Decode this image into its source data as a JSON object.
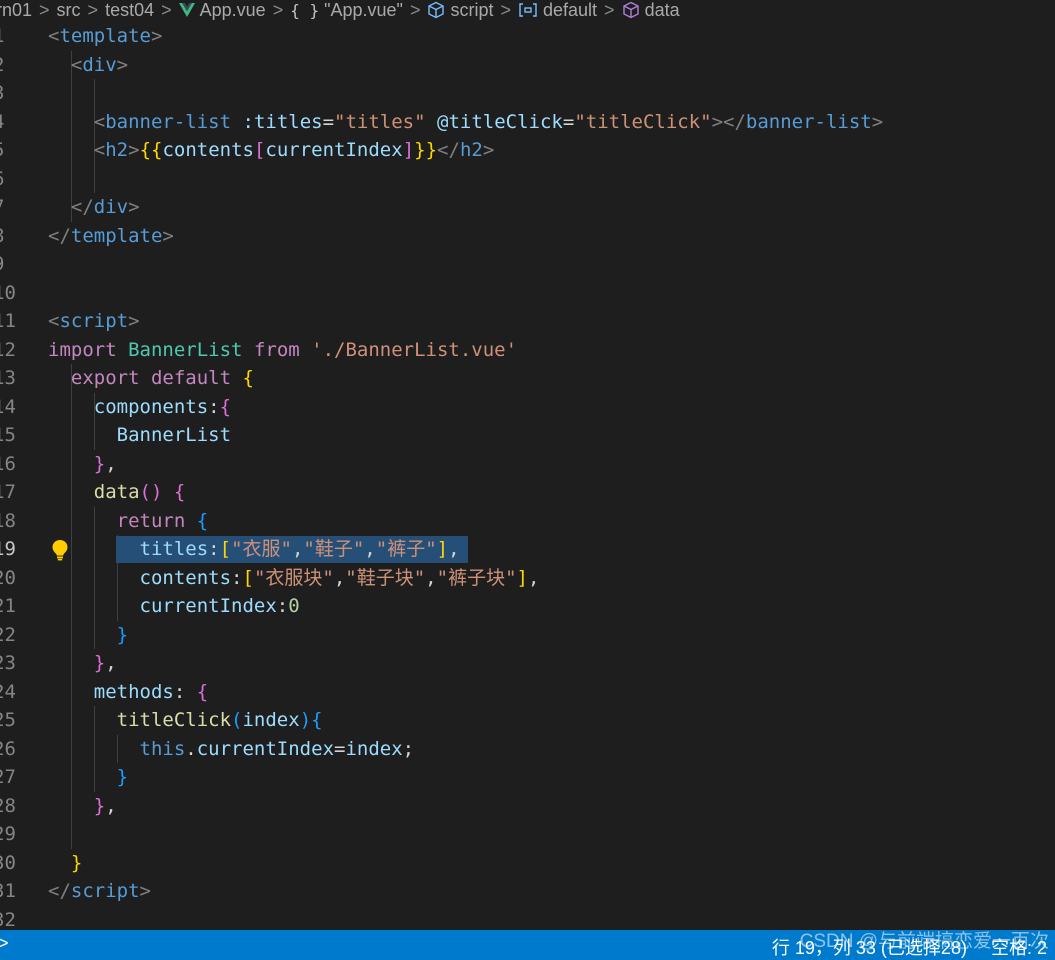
{
  "breadcrumb": {
    "items": [
      {
        "label": "rn01",
        "icon": ""
      },
      {
        "label": "src",
        "icon": ""
      },
      {
        "label": "test04",
        "icon": ""
      },
      {
        "label": "App.vue",
        "icon": "vue-icon"
      },
      {
        "label": "\"App.vue\"",
        "icon": "braces-icon"
      },
      {
        "label": "script",
        "icon": "cube-icon"
      },
      {
        "label": "default",
        "icon": "brackets-icon"
      },
      {
        "label": "data",
        "icon": "cube-icon"
      }
    ],
    "separator": ">"
  },
  "editor": {
    "active_line": 19,
    "lightbulb_line": 19,
    "lines": [
      {
        "num": "1",
        "tokens": [
          [
            "t-pun",
            "<"
          ],
          [
            "t-tag",
            "template"
          ],
          [
            "t-pun",
            ">"
          ]
        ]
      },
      {
        "num": "2",
        "tokens": [
          [
            "t-w",
            "  "
          ],
          [
            "t-pun",
            "<"
          ],
          [
            "t-tag",
            "div"
          ],
          [
            "t-pun",
            ">"
          ]
        ]
      },
      {
        "num": "3",
        "tokens": []
      },
      {
        "num": "4",
        "tokens": [
          [
            "t-w",
            "    "
          ],
          [
            "t-pun",
            "<"
          ],
          [
            "t-tag",
            "banner-list"
          ],
          [
            "t-w",
            " "
          ],
          [
            "t-attr",
            ":titles"
          ],
          [
            "t-w",
            "="
          ],
          [
            "t-str",
            "\"titles\""
          ],
          [
            "t-w",
            " "
          ],
          [
            "t-attr",
            "@titleClick"
          ],
          [
            "t-w",
            "="
          ],
          [
            "t-str",
            "\"titleClick\""
          ],
          [
            "t-pun",
            "></"
          ],
          [
            "t-tag",
            "banner-list"
          ],
          [
            "t-pun",
            ">"
          ]
        ]
      },
      {
        "num": "5",
        "tokens": [
          [
            "t-w",
            "    "
          ],
          [
            "t-pun",
            "<"
          ],
          [
            "t-tag",
            "h2"
          ],
          [
            "t-pun",
            ">"
          ],
          [
            "b1",
            "{{"
          ],
          [
            "t-prop",
            "contents"
          ],
          [
            "b2",
            "["
          ],
          [
            "t-prop",
            "currentIndex"
          ],
          [
            "b2",
            "]"
          ],
          [
            "b1",
            "}}"
          ],
          [
            "t-pun",
            "</"
          ],
          [
            "t-tag",
            "h2"
          ],
          [
            "t-pun",
            ">"
          ]
        ]
      },
      {
        "num": "6",
        "tokens": []
      },
      {
        "num": "7",
        "tokens": [
          [
            "t-w",
            "  "
          ],
          [
            "t-pun",
            "</"
          ],
          [
            "t-tag",
            "div"
          ],
          [
            "t-pun",
            ">"
          ]
        ]
      },
      {
        "num": "8",
        "tokens": [
          [
            "t-pun",
            "</"
          ],
          [
            "t-tag",
            "template"
          ],
          [
            "t-pun",
            ">"
          ]
        ]
      },
      {
        "num": "9",
        "tokens": []
      },
      {
        "num": "10",
        "tokens": []
      },
      {
        "num": "11",
        "tokens": [
          [
            "t-pun",
            "<"
          ],
          [
            "t-tag",
            "script"
          ],
          [
            "t-pun",
            ">"
          ]
        ]
      },
      {
        "num": "12",
        "tokens": [
          [
            "t-kw",
            "import"
          ],
          [
            "t-w",
            " "
          ],
          [
            "t-cls",
            "BannerList"
          ],
          [
            "t-w",
            " "
          ],
          [
            "t-kw",
            "from"
          ],
          [
            "t-w",
            " "
          ],
          [
            "t-str",
            "'./BannerList.vue'"
          ]
        ]
      },
      {
        "num": "13",
        "tokens": [
          [
            "t-w",
            "  "
          ],
          [
            "t-kw",
            "export"
          ],
          [
            "t-w",
            " "
          ],
          [
            "t-kw",
            "default"
          ],
          [
            "t-w",
            " "
          ],
          [
            "b1",
            "{"
          ]
        ]
      },
      {
        "num": "14",
        "tokens": [
          [
            "t-w",
            "    "
          ],
          [
            "t-prop",
            "components"
          ],
          [
            "t-w",
            ":"
          ],
          [
            "b2",
            "{"
          ]
        ]
      },
      {
        "num": "15",
        "tokens": [
          [
            "t-w",
            "      "
          ],
          [
            "t-prop",
            "BannerList"
          ]
        ]
      },
      {
        "num": "16",
        "tokens": [
          [
            "t-w",
            "    "
          ],
          [
            "b2",
            "}"
          ],
          [
            "t-w",
            ","
          ]
        ]
      },
      {
        "num": "17",
        "tokens": [
          [
            "t-w",
            "    "
          ],
          [
            "t-fn",
            "data"
          ],
          [
            "b2",
            "()"
          ],
          [
            "t-w",
            " "
          ],
          [
            "b2",
            "{"
          ]
        ]
      },
      {
        "num": "18",
        "tokens": [
          [
            "t-w",
            "      "
          ],
          [
            "t-kw",
            "return"
          ],
          [
            "t-w",
            " "
          ],
          [
            "b3",
            "{"
          ]
        ]
      },
      {
        "num": "19",
        "tokens": [
          [
            "t-w",
            "        "
          ],
          [
            "t-prop",
            "titles"
          ],
          [
            "t-w",
            ":"
          ],
          [
            "b1",
            "["
          ],
          [
            "t-str",
            "\"衣服\""
          ],
          [
            "t-w",
            ","
          ],
          [
            "t-str",
            "\"鞋子\""
          ],
          [
            "t-w",
            ","
          ],
          [
            "t-str",
            "\"裤子\""
          ],
          [
            "b1",
            "]"
          ],
          [
            "t-w",
            ","
          ]
        ]
      },
      {
        "num": "20",
        "tokens": [
          [
            "t-w",
            "        "
          ],
          [
            "t-prop",
            "contents"
          ],
          [
            "t-w",
            ":"
          ],
          [
            "b1",
            "["
          ],
          [
            "t-str",
            "\"衣服块\""
          ],
          [
            "t-w",
            ","
          ],
          [
            "t-str",
            "\"鞋子块\""
          ],
          [
            "t-w",
            ","
          ],
          [
            "t-str",
            "\"裤子块\""
          ],
          [
            "b1",
            "]"
          ],
          [
            "t-w",
            ","
          ]
        ]
      },
      {
        "num": "21",
        "tokens": [
          [
            "t-w",
            "        "
          ],
          [
            "t-prop",
            "currentIndex"
          ],
          [
            "t-w",
            ":"
          ],
          [
            "t-num",
            "0"
          ]
        ]
      },
      {
        "num": "22",
        "tokens": [
          [
            "t-w",
            "      "
          ],
          [
            "b3",
            "}"
          ]
        ]
      },
      {
        "num": "23",
        "tokens": [
          [
            "t-w",
            "    "
          ],
          [
            "b2",
            "}"
          ],
          [
            "t-w",
            ","
          ]
        ]
      },
      {
        "num": "24",
        "tokens": [
          [
            "t-w",
            "    "
          ],
          [
            "t-prop",
            "methods"
          ],
          [
            "t-w",
            ": "
          ],
          [
            "b2",
            "{"
          ]
        ]
      },
      {
        "num": "25",
        "tokens": [
          [
            "t-w",
            "      "
          ],
          [
            "t-fn",
            "titleClick"
          ],
          [
            "b3",
            "("
          ],
          [
            "t-prop",
            "index"
          ],
          [
            "b3",
            ")"
          ],
          [
            "b3",
            "{"
          ]
        ]
      },
      {
        "num": "26",
        "tokens": [
          [
            "t-w",
            "        "
          ],
          [
            "t-kb",
            "this"
          ],
          [
            "t-w",
            "."
          ],
          [
            "t-prop",
            "currentIndex"
          ],
          [
            "t-w",
            "="
          ],
          [
            "t-prop",
            "index"
          ],
          [
            "t-w",
            ";"
          ]
        ]
      },
      {
        "num": "27",
        "tokens": [
          [
            "t-w",
            "      "
          ],
          [
            "b3",
            "}"
          ]
        ]
      },
      {
        "num": "28",
        "tokens": [
          [
            "t-w",
            "    "
          ],
          [
            "b2",
            "}"
          ],
          [
            "t-w",
            ","
          ]
        ]
      },
      {
        "num": "29",
        "tokens": []
      },
      {
        "num": "30",
        "tokens": [
          [
            "t-w",
            "  "
          ],
          [
            "b1",
            "}"
          ]
        ]
      },
      {
        "num": "31",
        "tokens": [
          [
            "t-pun",
            "</"
          ],
          [
            "t-tag",
            "script"
          ],
          [
            "t-pun",
            ">"
          ]
        ]
      },
      {
        "num": "32",
        "tokens": []
      }
    ]
  },
  "statusbar": {
    "left_icon": ">",
    "cursor_position": "行 19，列 33 (已选择28)",
    "indent": "空格: 2"
  },
  "watermark": {
    "text": "CSDN @与前端搞恋爱一百次"
  },
  "colors": {
    "editor_bg": "#1e1e1e",
    "statusbar_bg": "#007acc",
    "selection_bg": "#264f78"
  }
}
